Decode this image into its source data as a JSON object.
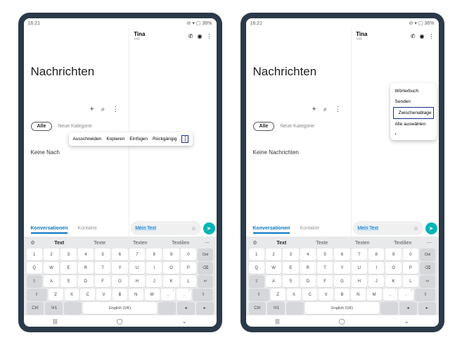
{
  "status": {
    "time": "16:21",
    "battery": "36%"
  },
  "left_pane": {
    "title": "Nachrichten",
    "filter_all": "Alle",
    "filter_new": "Neue Kategorie",
    "empty_full": "Keine Nachrichten",
    "empty_trunc": "Keine Nach",
    "seg_conv": "Konversationen",
    "seg_contacts": "Kontakte"
  },
  "chat": {
    "name": "Tina",
    "number": "+49",
    "input_text": "Mein Text"
  },
  "context_popup": {
    "cut": "Ausschneiden",
    "copy": "Kopieren",
    "paste": "Einfügen",
    "undo": "Rückgängig"
  },
  "context_menu": {
    "dict": "Wörterbuch",
    "send": "Senden",
    "clipboard": "Zwischenablage",
    "select_all": "Alle auswählen"
  },
  "suggestions": {
    "s1": "Text",
    "s2": "Texte",
    "s3": "Texten",
    "s4": "Textilien"
  },
  "keys": {
    "num": [
      "1",
      "2",
      "3",
      "4",
      "5",
      "6",
      "7",
      "8",
      "9",
      "0"
    ],
    "del": "Del",
    "q": [
      "Q",
      "W",
      "E",
      "R",
      "T",
      "Y",
      "U",
      "I",
      "O",
      "P"
    ],
    "a": [
      "A",
      "S",
      "D",
      "F",
      "G",
      "H",
      "J",
      "K",
      "L"
    ],
    "z": [
      "Z",
      "X",
      "C",
      "V",
      "B",
      "N",
      "M"
    ],
    "ctrl": "Ctrl",
    "sym": "!#1",
    "lang": "English (UK)"
  }
}
